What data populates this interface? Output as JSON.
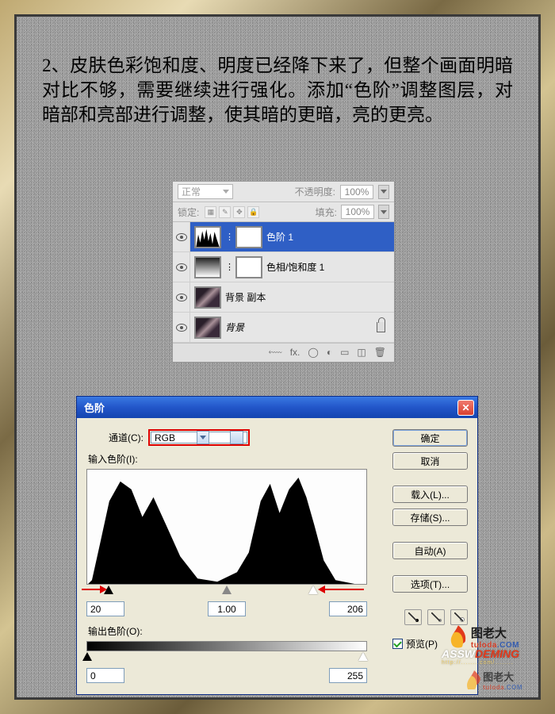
{
  "instruction": "2、皮肤色彩饱和度、明度已经降下来了，但整个画面明暗对比不够，需要继续进行强化。添加“色阶”调整图层，对暗部和亮部进行调整，使其暗的更暗，亮的更亮。",
  "layers_panel": {
    "blend_mode": "正常",
    "opacity_label": "不透明度:",
    "opacity_value": "100%",
    "lock_label": "锁定:",
    "fill_label": "填充:",
    "fill_value": "100%",
    "layers": [
      {
        "name": "色阶 1",
        "selected": true,
        "type": "levels"
      },
      {
        "name": "色相/饱和度 1",
        "selected": false,
        "type": "hue"
      },
      {
        "name": "背景 副本",
        "selected": false,
        "type": "image"
      },
      {
        "name": "背景",
        "selected": false,
        "type": "image_locked",
        "italic": true
      }
    ],
    "toolbar_icons": [
      "link-icon",
      "fx-icon",
      "mask-icon",
      "adjust-icon",
      "folder-icon",
      "new-icon",
      "trash-icon"
    ]
  },
  "levels_dialog": {
    "title": "色阶",
    "channel_label": "通道(C):",
    "channel_value": "RGB",
    "input_label": "输入色阶(I):",
    "input_black": "20",
    "input_gamma": "1.00",
    "input_white": "206",
    "output_label": "输出色阶(O):",
    "output_black": "0",
    "output_white": "255",
    "buttons": {
      "ok": "确定",
      "cancel": "取消",
      "load": "载入(L)...",
      "save": "存储(S)...",
      "auto": "自动(A)",
      "options": "选项(T)..."
    },
    "preview_label": "预览(P)"
  },
  "watermarks": {
    "brand_cn": "图老大",
    "brand_en_1": "tuloda",
    "brand_en_2": ".COM",
    "assw": "ASSW",
    "deming": "DEMING"
  }
}
